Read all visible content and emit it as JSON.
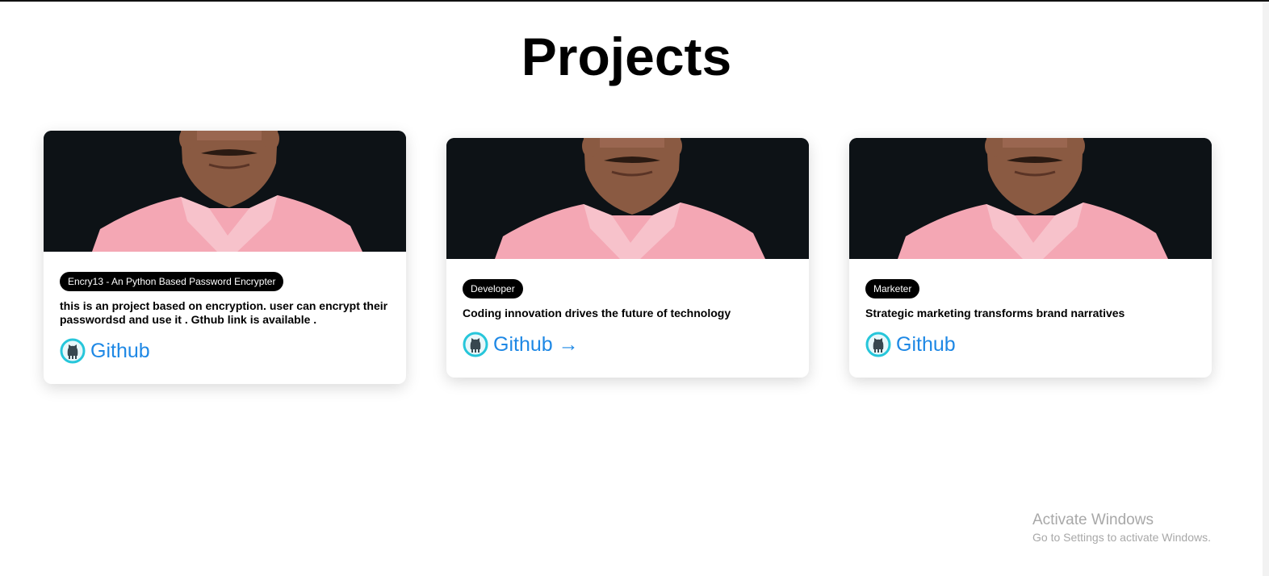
{
  "page": {
    "title": "Projects"
  },
  "projects": [
    {
      "tag": "Encry13 - An Python Based Password Encrypter",
      "description": "this is an project based on encryption. user can encrypt their passwordsd and use it . Gthub link is available .",
      "link_label": "Github"
    },
    {
      "tag": "Developer",
      "description": "Coding innovation drives the future of technology",
      "link_label": "Github →"
    },
    {
      "tag": "Marketer",
      "description": "Strategic marketing transforms brand narratives",
      "link_label": "Github"
    }
  ],
  "icons": {
    "github": "github-icon"
  },
  "colors": {
    "link": "#1e88e5",
    "tag_bg": "#000000",
    "photo_bg": "#0d1216",
    "icon_ring": "#26c6da"
  },
  "watermark": {
    "line1": "Activate Windows",
    "line2": "Go to Settings to activate Windows."
  }
}
